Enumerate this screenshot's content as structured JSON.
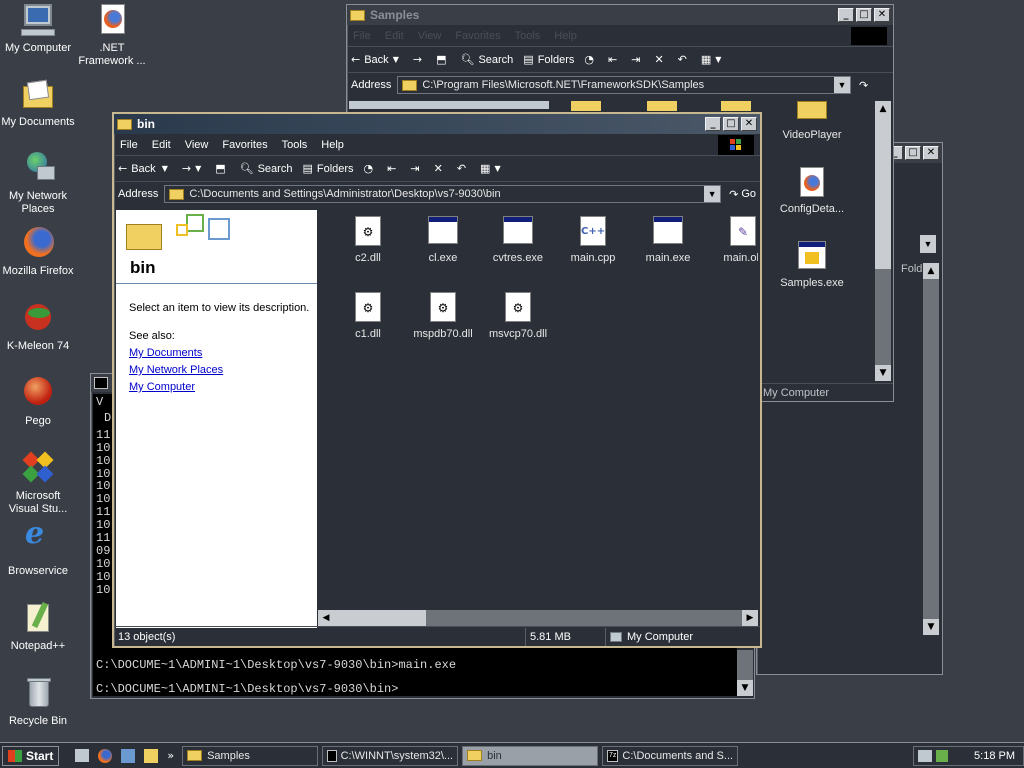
{
  "desktop": {
    "icons": [
      {
        "label": "My Computer"
      },
      {
        "label": ".NET Framework ..."
      },
      {
        "label": "My Documents"
      },
      {
        "label": "My Network Places"
      },
      {
        "label": "Mozilla Firefox"
      },
      {
        "label": "K-Meleon 74"
      },
      {
        "label": "Pego"
      },
      {
        "label": "Microsoft Visual Stu..."
      },
      {
        "label": "Browservice"
      },
      {
        "label": "Notepad++"
      },
      {
        "label": "Recycle Bin"
      }
    ]
  },
  "samples_window": {
    "title": "Samples",
    "menu": [
      "File",
      "Edit",
      "View",
      "Favorites",
      "Tools",
      "Help"
    ],
    "toolbar": {
      "back": "Back",
      "search": "Search",
      "folders": "Folders"
    },
    "address_label": "Address",
    "address": "C:\\Program Files\\Microsoft.NET\\FrameworkSDK\\Samples",
    "files": [
      {
        "name": "VideoPlayer"
      },
      {
        "name": "ConfigDeta..."
      },
      {
        "name": "Samples.exe"
      }
    ],
    "status_location": "My Computer"
  },
  "third_window": {
    "status_folder": "Fold"
  },
  "bin_window": {
    "title": "bin",
    "menu": [
      "File",
      "Edit",
      "View",
      "Favorites",
      "Tools",
      "Help"
    ],
    "toolbar": {
      "back": "Back",
      "search": "Search",
      "folders": "Folders"
    },
    "address_label": "Address",
    "address": "C:\\Documents and Settings\\Administrator\\Desktop\\vs7-9030\\bin",
    "go_label": "Go",
    "left_panel": {
      "folder_name": "bin",
      "description": "Select an item to view its description.",
      "see_also": "See also:",
      "links": [
        "My Documents",
        "My Network Places",
        "My Computer"
      ]
    },
    "files": [
      {
        "name": "c2.dll",
        "type": "dll"
      },
      {
        "name": "cl.exe",
        "type": "exe"
      },
      {
        "name": "cvtres.exe",
        "type": "exe"
      },
      {
        "name": "main.cpp",
        "type": "cpp"
      },
      {
        "name": "main.exe",
        "type": "exe"
      },
      {
        "name": "main.ob",
        "type": "obj"
      },
      {
        "name": "c1.dll",
        "type": "dll"
      },
      {
        "name": "mspdb70.dll",
        "type": "dll"
      },
      {
        "name": "msvcp70.dll",
        "type": "dll"
      }
    ],
    "status": {
      "objects": "13 object(s)",
      "size": "5.81 MB",
      "location": "My Computer"
    }
  },
  "console": {
    "left_column": [
      "V",
      "D",
      "11",
      "10",
      "10",
      "10",
      "10",
      "10",
      "11",
      "10",
      "11",
      "09",
      "10",
      "10",
      "10"
    ],
    "line1": "C:\\DOCUME~1\\ADMINI~1\\Desktop\\vs7-9030\\bin>main.exe",
    "line2": "C:\\DOCUME~1\\ADMINI~1\\Desktop\\vs7-9030\\bin>"
  },
  "taskbar": {
    "start_label": "Start",
    "tasks": [
      {
        "label": "Samples",
        "active": false
      },
      {
        "label": "C:\\WINNT\\system32\\...",
        "active": false
      },
      {
        "label": "bin",
        "active": true
      },
      {
        "label": "C:\\Documents and S...",
        "active": false
      }
    ],
    "clock": "5:18 PM"
  },
  "colors": {
    "desktop_bg": "#3a3f47",
    "window_bg": "#2b3038",
    "titlebar_active": "#4a5868",
    "link": "#0000cc"
  }
}
